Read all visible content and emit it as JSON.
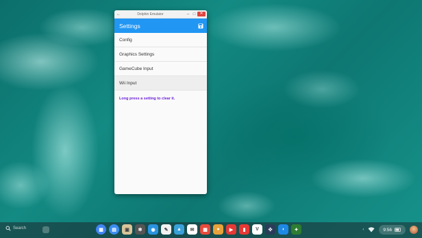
{
  "window": {
    "title": "Dolphin Emulator",
    "back_glyph": "←",
    "minimize_glyph": "–",
    "maximize_glyph": "□",
    "close_glyph": "✕"
  },
  "appbar": {
    "title": "Settings",
    "save_icon": "save-icon",
    "accent_color": "#2196f3"
  },
  "menu": [
    {
      "label": "Config",
      "selected": false
    },
    {
      "label": "Graphics Settings",
      "selected": false
    },
    {
      "label": "GameCube Input",
      "selected": false
    },
    {
      "label": "Wii Input",
      "selected": true
    }
  ],
  "hint": {
    "text": "Long press a setting to clear it.",
    "color": "#6a1fd6"
  },
  "taskbar": {
    "search_text": "Search",
    "clock": "9:56",
    "apps": [
      {
        "name": "app-launcher-icon",
        "color": "#4285f4",
        "glyph": "▦"
      },
      {
        "name": "files-icon",
        "color": "#3b8df0",
        "glyph": "▤"
      },
      {
        "name": "photos-icon",
        "color": "#d8c59a",
        "glyph": "▣"
      },
      {
        "name": "steering-icon",
        "color": "#555555",
        "glyph": "✻"
      },
      {
        "name": "chat-icon",
        "color": "#2a93e0",
        "glyph": "◉"
      },
      {
        "name": "notes-icon",
        "color": "#f1f1f1",
        "glyph": "✎"
      },
      {
        "name": "gallery-icon",
        "color": "#3aa0d8",
        "glyph": "▲"
      },
      {
        "name": "mail-icon",
        "color": "#ffffff",
        "glyph": "✉"
      },
      {
        "name": "calendar-icon",
        "color": "#e84a3c",
        "glyph": "▦"
      },
      {
        "name": "chrome-icon",
        "color": "#e8a23a",
        "glyph": "●"
      },
      {
        "name": "youtube-icon",
        "color": "#e53935",
        "glyph": "▶"
      },
      {
        "name": "news-icon",
        "color": "#e53935",
        "glyph": "▮"
      },
      {
        "name": "vectorize-icon",
        "color": "#ffffff",
        "glyph": "V"
      },
      {
        "name": "games-icon",
        "color": "#2a3c5a",
        "glyph": "✜"
      },
      {
        "name": "dolphin-icon",
        "color": "#1e88e5",
        "glyph": "◗"
      },
      {
        "name": "bird-icon",
        "color": "#2e7d32",
        "glyph": "✦"
      }
    ]
  }
}
